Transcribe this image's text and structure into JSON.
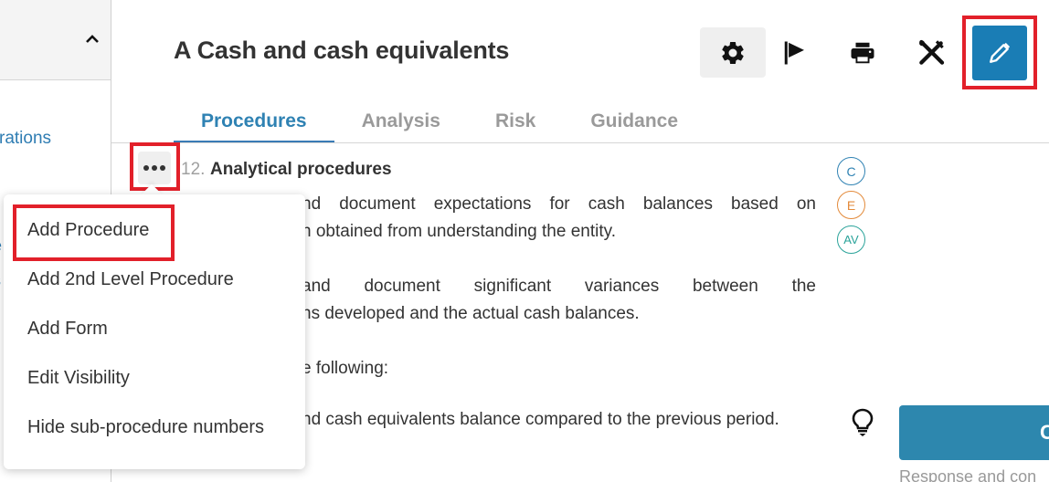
{
  "sidebar": {
    "collapse_icon": "chevron-up-icon",
    "links": [
      "rations",
      "e",
      "s"
    ]
  },
  "header": {
    "title": "A Cash and cash equivalents",
    "toolbar": [
      {
        "name": "settings",
        "icon": "gear-icon"
      },
      {
        "name": "flag",
        "icon": "flag-icon"
      },
      {
        "name": "print",
        "icon": "printer-icon"
      },
      {
        "name": "tools",
        "icon": "tools-icon"
      },
      {
        "name": "edit",
        "icon": "pencil-icon",
        "highlighted": true
      }
    ],
    "edit_button_color": "#1a7db5"
  },
  "tabs": [
    {
      "label": "Procedures",
      "active": true
    },
    {
      "label": "Analysis",
      "active": false
    },
    {
      "label": "Risk",
      "active": false
    },
    {
      "label": "Guidance",
      "active": false
    }
  ],
  "procedure": {
    "number": "12.",
    "title": "Analytical procedures",
    "text_lines": [
      "nd document expectations for cash balances based on",
      "n obtained from understanding the entity.",
      "and document significant variances between the",
      "ns developed and the actual cash balances.",
      "e following:",
      "nd cash equivalents balance compared to the previous period."
    ],
    "assertion_badges": [
      {
        "label": "C",
        "color": "#2f82b3"
      },
      {
        "label": "E",
        "color": "#e38a3a"
      },
      {
        "label": "AV",
        "color": "#2aa39a"
      }
    ],
    "hint_icon": "lightbulb-icon",
    "action_button_label": "C",
    "action_button_color": "#2d87ae",
    "response_caption": "Response and con"
  },
  "context_menu": {
    "items": [
      {
        "label": "Add Procedure",
        "highlighted": true
      },
      {
        "label": "Add 2nd Level Procedure"
      },
      {
        "label": "Add Form"
      },
      {
        "label": "Edit Visibility"
      },
      {
        "label": "Hide sub-procedure numbers"
      }
    ]
  },
  "highlight_color": "#e2202a"
}
